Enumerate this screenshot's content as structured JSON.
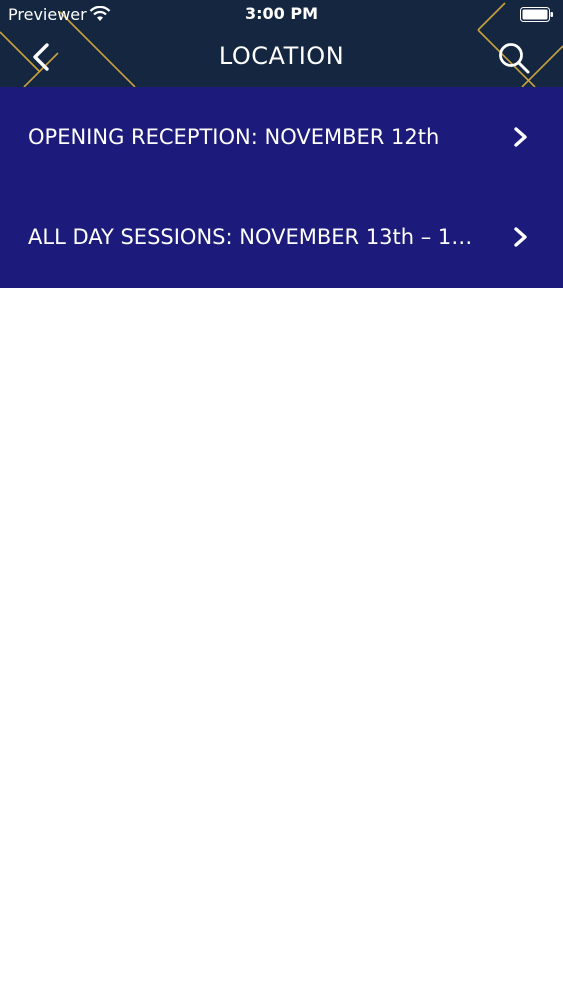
{
  "status_bar": {
    "carrier": "Previewer",
    "time": "3:00 PM"
  },
  "header": {
    "title": "LOCATION",
    "back_icon": "chevron-left-icon",
    "search_icon": "search-icon"
  },
  "colors": {
    "header_bg": "#142640",
    "list_bg": "#1c1a7a",
    "accent_lines": "#c9a23f",
    "text": "#ffffff"
  },
  "locations": [
    {
      "label": "OPENING RECEPTION: NOVEMBER 12th"
    },
    {
      "label": "ALL DAY SESSIONS: NOVEMBER 13th – 1…"
    }
  ]
}
